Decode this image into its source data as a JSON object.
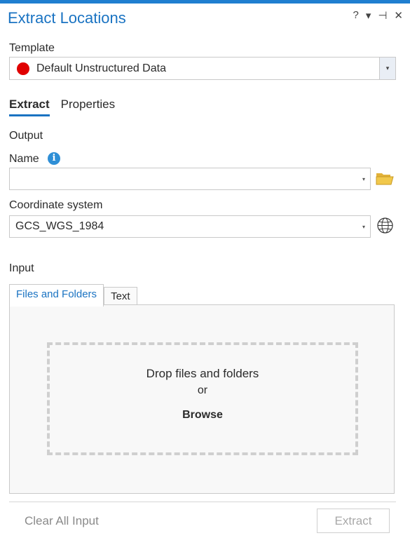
{
  "header": {
    "title": "Extract Locations",
    "help": "?",
    "menu": "▾",
    "pin": "⊣",
    "close": "✕"
  },
  "template": {
    "label": "Template",
    "value": "Default Unstructured Data",
    "dot_color": "#e00000",
    "dropdown_arrow": "▾"
  },
  "tabs": [
    {
      "label": "Extract",
      "active": true
    },
    {
      "label": "Properties",
      "active": false
    }
  ],
  "output": {
    "heading": "Output",
    "name_label": "Name",
    "name_value": "",
    "info_glyph": "i",
    "coord_label": "Coordinate system",
    "coord_value": "GCS_WGS_1984",
    "dropdown_arrow": "▾"
  },
  "input": {
    "heading": "Input",
    "tabs": [
      {
        "label": "Files and Folders",
        "active": true
      },
      {
        "label": "Text",
        "active": false
      }
    ],
    "drop_text": "Drop files and folders",
    "or_text": "or",
    "browse_label": "Browse"
  },
  "footer": {
    "clear_label": "Clear All Input",
    "extract_label": "Extract"
  },
  "colors": {
    "accent": "#1a73c2",
    "top_bar": "#1f7fd0",
    "disabled_text": "#a8a8a8"
  }
}
